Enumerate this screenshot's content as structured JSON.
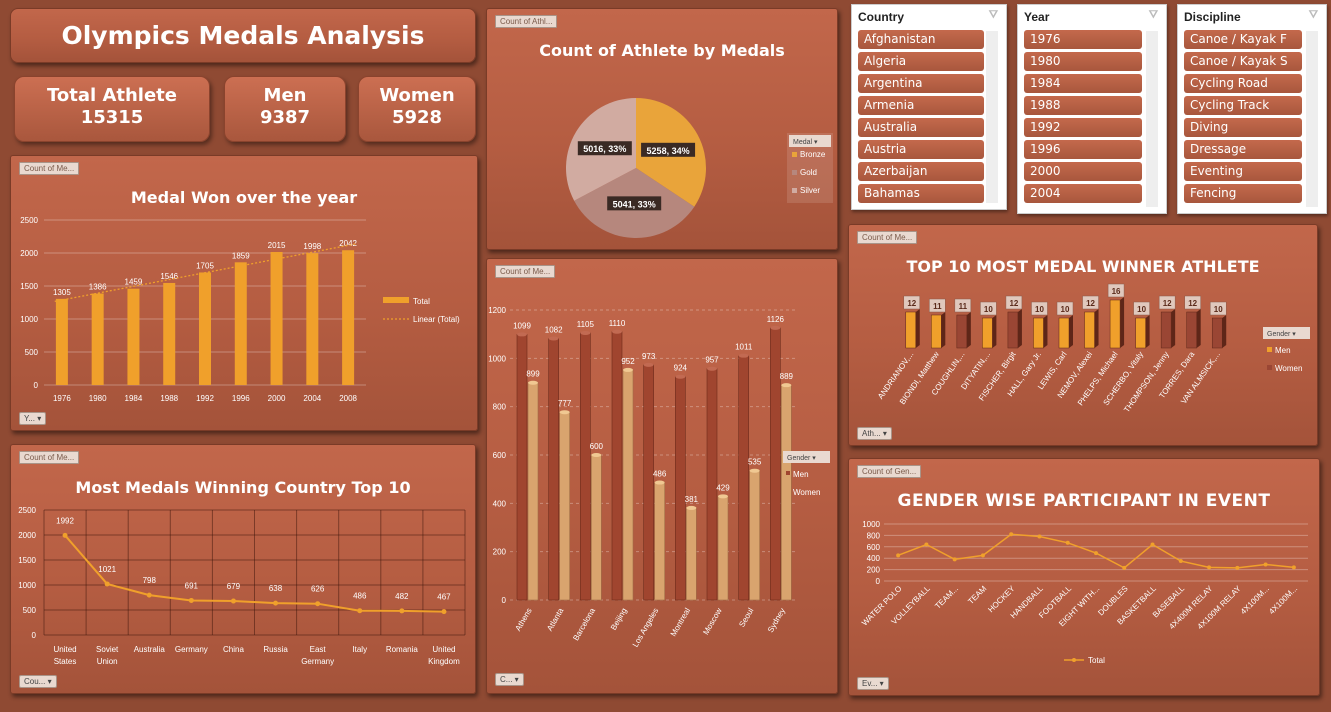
{
  "title": "Olympics Medals Analysis",
  "kpis": [
    {
      "label": "Total Athlete",
      "value": "15315"
    },
    {
      "label": "Men",
      "value": "9387"
    },
    {
      "label": "Women",
      "value": "5928"
    }
  ],
  "colors": {
    "orange": "#f0a02b",
    "brown": "#8a4030",
    "gold": "#e9a43a",
    "rose": "#b6877d",
    "silver": "#d1aba1"
  },
  "tags": {
    "medal_year": "Count of Me...",
    "medal_pie": "Count of Athl...",
    "top_country": "Count of Me...",
    "city": "Count of Me...",
    "athlete": "Count of Me...",
    "gender_event": "Count of Gen..."
  },
  "dropdowns": {
    "year": "Y...",
    "country": "Cou...",
    "city": "C...",
    "athlete": "Ath...",
    "event": "Ev...",
    "medal": "Medal",
    "gender1": "Gender",
    "gender2": "Gender"
  },
  "slicers": [
    {
      "title": "Country",
      "items": [
        "Afghanistan",
        "Algeria",
        "Argentina",
        "Armenia",
        "Australia",
        "Austria",
        "Azerbaijan",
        "Bahamas"
      ]
    },
    {
      "title": "Year",
      "items": [
        "1976",
        "1980",
        "1984",
        "1988",
        "1992",
        "1996",
        "2000",
        "2004"
      ]
    },
    {
      "title": "Discipline",
      "items": [
        "Canoe / Kayak F",
        "Canoe / Kayak S",
        "Cycling Road",
        "Cycling Track",
        "Diving",
        "Dressage",
        "Eventing",
        "Fencing"
      ]
    }
  ],
  "chart_data": [
    {
      "id": "medals_year",
      "type": "bar",
      "title": "Medal Won over the year",
      "categories": [
        "1976",
        "1980",
        "1984",
        "1988",
        "1992",
        "1996",
        "2000",
        "2004",
        "2008"
      ],
      "series": [
        {
          "name": "Total",
          "values": [
            1305,
            1386,
            1459,
            1546,
            1705,
            1859,
            2015,
            1998,
            2042
          ]
        }
      ],
      "trendline": "Linear (Total)",
      "ylim": [
        0,
        2500
      ],
      "yticks": [
        "0",
        "500",
        "1000",
        "1500",
        "2000",
        "2500"
      ],
      "legend": "right"
    },
    {
      "id": "medal_pie",
      "type": "pie",
      "title": "Count of Athlete by Medals",
      "categories": [
        "Bronze",
        "Gold",
        "Silver"
      ],
      "values": [
        5258,
        5041,
        5016
      ],
      "labels": [
        "5258, 34%",
        "5041, 33%",
        "5016, 33%"
      ],
      "legend": "right"
    },
    {
      "id": "top_country",
      "type": "line",
      "title": "Most Medals Winning Country Top 10",
      "categories": [
        "United States",
        "Soviet Union",
        "Australia",
        "Germany",
        "China",
        "Russia",
        "East Germany",
        "Italy",
        "Romania",
        "United Kingdom"
      ],
      "values": [
        1992,
        1021,
        798,
        691,
        679,
        638,
        626,
        486,
        482,
        467
      ],
      "ylim": [
        0,
        2500
      ],
      "yticks": [
        "0",
        "500",
        "1000",
        "1500",
        "2000",
        "2500"
      ],
      "grid": true
    },
    {
      "id": "city_gender",
      "type": "bar",
      "categories": [
        "Athens",
        "Atlanta",
        "Barcelona",
        "Beijing",
        "Los Angeles",
        "Montreal",
        "Moscow",
        "Seoul",
        "Sydney"
      ],
      "series": [
        {
          "name": "Men",
          "values": [
            1099,
            1082,
            1105,
            1110,
            973,
            924,
            957,
            1011,
            1126
          ]
        },
        {
          "name": "Women",
          "values": [
            899,
            777,
            600,
            952,
            486,
            381,
            429,
            535,
            889
          ]
        }
      ],
      "ylim": [
        0,
        1200
      ],
      "yticks": [
        "0",
        "200",
        "400",
        "600",
        "800",
        "1000",
        "1200"
      ],
      "legend": "right"
    },
    {
      "id": "top_athlete",
      "type": "bar",
      "title": "TOP 10 MOST MEDAL WINNER ATHLETE",
      "categories": [
        "ANDRIANOV,...",
        "BIONDI, Matthew",
        "COUGHLIN,...",
        "DITYATIN,...",
        "FISCHER, Birgit",
        "HALL, Gary Jr.",
        "LEWIS, Carl",
        "NEMOV, Alexei",
        "PHELPS, Michael",
        "SCHERBO, Vitaly",
        "THOMPSON, Jenny",
        "TORRES, Dara",
        "VAN ALMSICK,..."
      ],
      "series": [
        {
          "name": "Men",
          "values": [
            12,
            11,
            null,
            10,
            null,
            10,
            10,
            12,
            16,
            10,
            null,
            null,
            null
          ]
        },
        {
          "name": "Women",
          "values": [
            null,
            null,
            11,
            null,
            12,
            null,
            null,
            null,
            null,
            null,
            12,
            12,
            10
          ]
        }
      ],
      "legend": "right"
    },
    {
      "id": "gender_event",
      "type": "line",
      "title": "GENDER WISE PARTICIPANT IN EVENT",
      "categories": [
        "WATER POLO",
        "VOLLEYBALL",
        "TEAM...",
        "TEAM",
        "HOCKEY",
        "HANDBALL",
        "FOOTBALL",
        "EIGHT WITH...",
        "DOUBLES",
        "BASKETBALL",
        "BASEBALL",
        "4X400M RELAY",
        "4X100M RELAY",
        "4X100M...",
        "4X100M..."
      ],
      "series": [
        {
          "name": "Total",
          "values": [
            450,
            640,
            380,
            450,
            820,
            780,
            670,
            490,
            230,
            640,
            350,
            240,
            230,
            290,
            240
          ]
        }
      ],
      "ylim": [
        0,
        1000
      ],
      "yticks": [
        "0",
        "200",
        "400",
        "600",
        "800",
        "1000"
      ],
      "legend": "bottom"
    }
  ]
}
